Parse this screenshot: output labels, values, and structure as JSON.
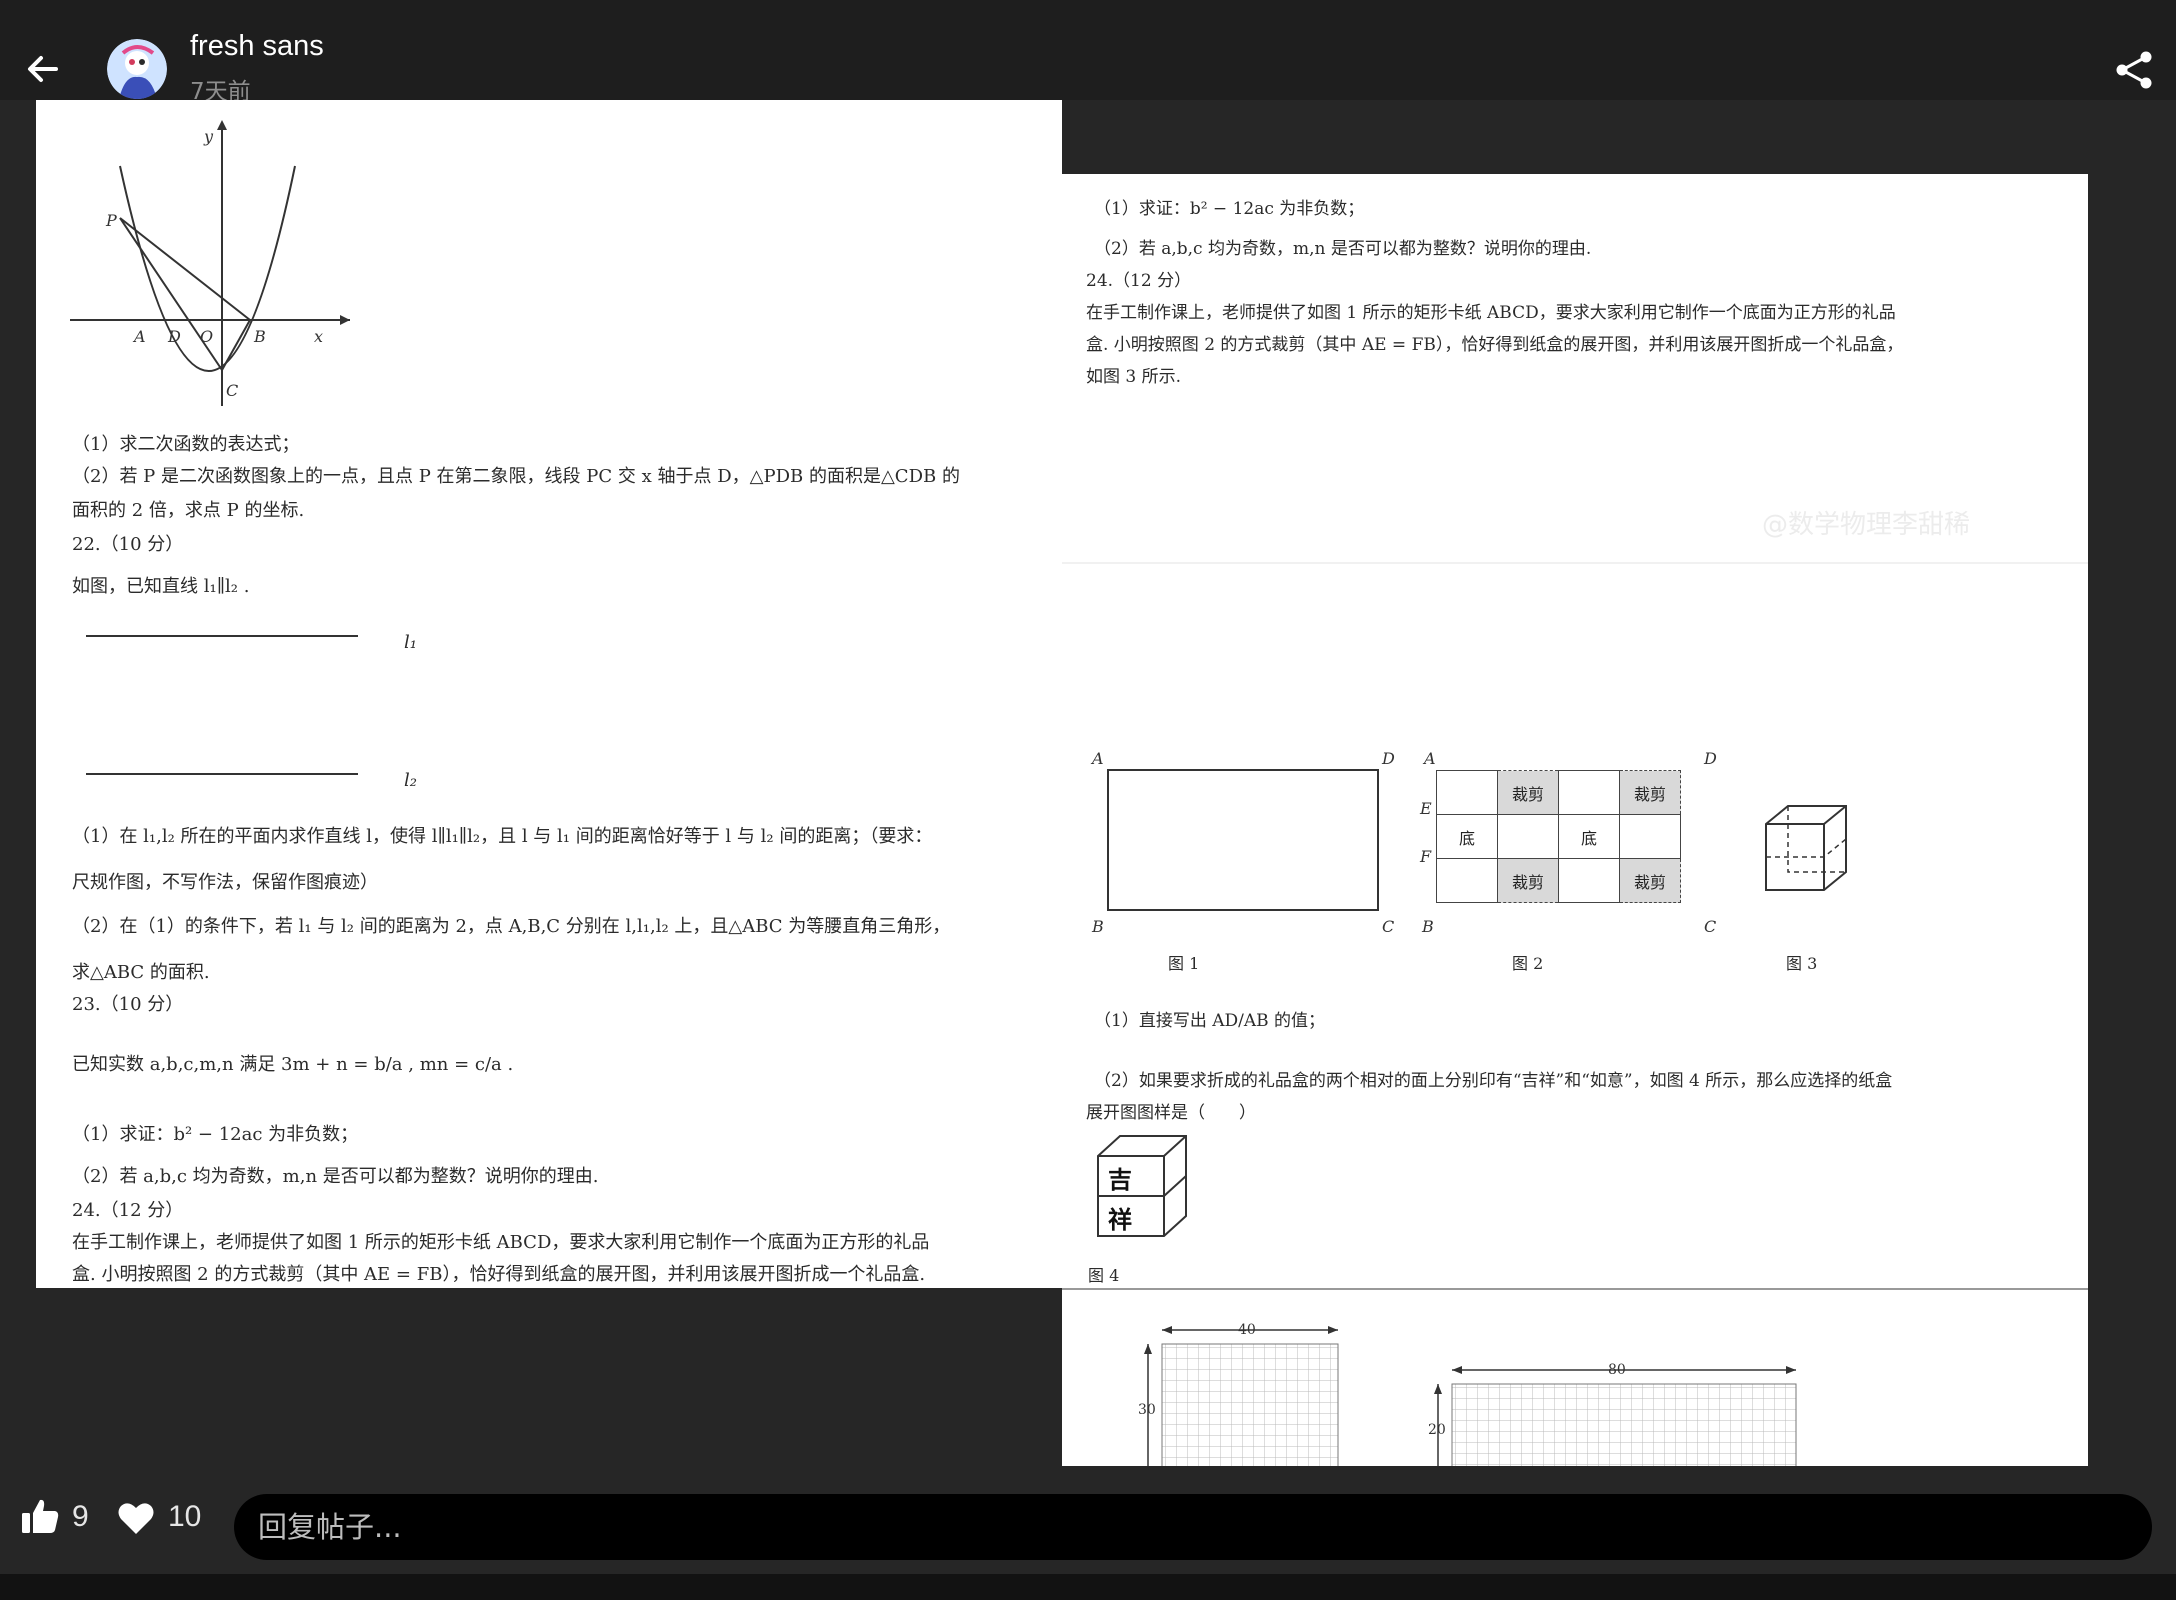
{
  "header": {
    "back_icon": "arrow-left-icon",
    "author_name": "fresh sans",
    "post_time": "7天前",
    "share_icon": "share-icon"
  },
  "left_page": {
    "graph_labels": [
      "y",
      "P",
      "A",
      "D",
      "O",
      "B",
      "x",
      "C"
    ],
    "q21_1": "（1）求二次函数的表达式；",
    "q21_2a": "（2）若 P 是二次函数图象上的一点，且点 P 在第二象限，线段 PC 交 x 轴于点 D，△PDB 的面积是△CDB 的",
    "q21_2b": "面积的 2 倍，求点 P 的坐标.",
    "q22_title": "22.（10 分）",
    "q22_intro": "如图，已知直线 l₁∥l₂ .",
    "line_l1": "l₁",
    "line_l2": "l₂",
    "q22_1a": "（1）在 l₁,l₂ 所在的平面内求作直线 l，使得 l∥l₁∥l₂，且 l 与 l₁ 间的距离恰好等于 l 与 l₂ 间的距离；（要求：",
    "q22_1b": "尺规作图，不写作法，保留作图痕迹）",
    "q22_2a": "（2）在（1）的条件下，若 l₁ 与 l₂ 间的距离为 2，点 A,B,C 分别在 l,l₁,l₂ 上，且△ABC 为等腰直角三角形，",
    "q22_2b": "求△ABC 的面积.",
    "q23_title": "23.（10 分）",
    "q23_intro": "已知实数 a,b,c,m,n 满足 3m + n = b/a , mn = c/a .",
    "q23_1": "（1）求证：b² − 12ac 为非负数；",
    "q23_2": "（2）若 a,b,c 均为奇数，m,n 是否可以都为整数？说明你的理由.",
    "q24_title": "24.（12 分）",
    "q24_a": "在手工制作课上，老师提供了如图 1 所示的矩形卡纸 ABCD，要求大家利用它制作一个底面为正方形的礼品",
    "q24_b": "盒. 小明按照图 2 的方式裁剪（其中 AE = FB），恰好得到纸盒的展开图，并利用该展开图折成一个礼品盒."
  },
  "right_page": {
    "q23_1": "（1）求证：b² − 12ac 为非负数；",
    "q23_2": "（2）若 a,b,c 均为奇数，m,n 是否可以都为整数？说明你的理由.",
    "q24_title": "24.（12 分）",
    "q24_a": "在手工制作课上，老师提供了如图 1 所示的矩形卡纸 ABCD，要求大家利用它制作一个底面为正方形的礼品",
    "q24_b": "盒. 小明按照图 2 的方式裁剪（其中 AE = FB），恰好得到纸盒的展开图，并利用该展开图折成一个礼品盒，",
    "q24_c": "如图 3 所示.",
    "watermark": "@数学物理李甜稀",
    "fig1_labels": [
      "A",
      "D",
      "B",
      "C"
    ],
    "fig2_labels": [
      "A",
      "D",
      "E",
      "F",
      "B",
      "C"
    ],
    "fig2_cut": "裁剪",
    "fig2_base": "底",
    "fig1_caption": "图 1",
    "fig2_caption": "图 2",
    "fig3_caption": "图 3",
    "q24_1": "（1）直接写出 AD/AB 的值；",
    "q24_2a": "（2）如果要求折成的礼品盒的两个相对的面上分别印有“吉祥”和“如意”，如图 4 所示，那么应选择的纸盒",
    "q24_2b": "展开图图样是（　　）",
    "fig4_chars": [
      "吉",
      "祥"
    ],
    "fig4_caption": "图 4",
    "grid1_width": "40",
    "grid1_height": "30",
    "grid2_width": "80",
    "grid2_height": "20"
  },
  "footer": {
    "like_icon": "thumbs-up-icon",
    "like_count": "9",
    "heart_icon": "heart-icon",
    "heart_count": "10",
    "reply_placeholder": "回复帖子..."
  }
}
